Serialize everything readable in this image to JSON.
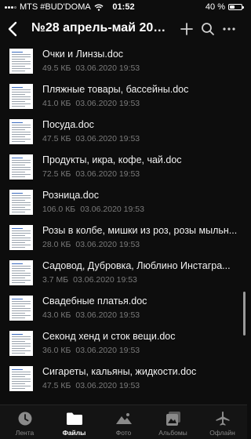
{
  "status_bar": {
    "carrier": "MTS #BUD'DOMA",
    "time": "01:52",
    "battery_text": "40 %",
    "battery_level": 0.4
  },
  "header": {
    "title": "№28 апрель-май 2020 ..."
  },
  "files": [
    {
      "name": "Очки и Линзы.doc",
      "size": "49.5 КБ",
      "date": "03.06.2020 19:53"
    },
    {
      "name": "Пляжные товары, бассейны.doc",
      "size": "41.0 КБ",
      "date": "03.06.2020 19:53"
    },
    {
      "name": "Посуда.doc",
      "size": "47.5 КБ",
      "date": "03.06.2020 19:53"
    },
    {
      "name": "Продукты, икра, кофе, чай.doc",
      "size": "72.5 КБ",
      "date": "03.06.2020 19:53"
    },
    {
      "name": "Розница.doc",
      "size": "106.0 КБ",
      "date": "03.06.2020 19:53"
    },
    {
      "name": "Розы в колбе, мишки из роз, розы мыльн...",
      "size": "28.0 КБ",
      "date": "03.06.2020 19:53"
    },
    {
      "name": "Садовод, Дубровка, Люблино Инстагра...",
      "size": "3.7 МБ",
      "date": "03.06.2020 19:53"
    },
    {
      "name": "Свадебные платья.doc",
      "size": "43.0 КБ",
      "date": "03.06.2020 19:53"
    },
    {
      "name": "Секонд хенд и сток вещи.doc",
      "size": "36.0 КБ",
      "date": "03.06.2020 19:53"
    },
    {
      "name": "Сигареты, кальяны, жидкости.doc",
      "size": "47.5 КБ",
      "date": "03.06.2020 19:53"
    }
  ],
  "tabs": [
    {
      "label": "Лента",
      "icon": "clock-icon",
      "active": false
    },
    {
      "label": "Файлы",
      "icon": "folder-icon",
      "active": true
    },
    {
      "label": "Фото",
      "icon": "mountain-icon",
      "active": false
    },
    {
      "label": "Альбомы",
      "icon": "albums-icon",
      "active": false
    },
    {
      "label": "Офлайн",
      "icon": "airplane-icon",
      "active": false
    }
  ]
}
